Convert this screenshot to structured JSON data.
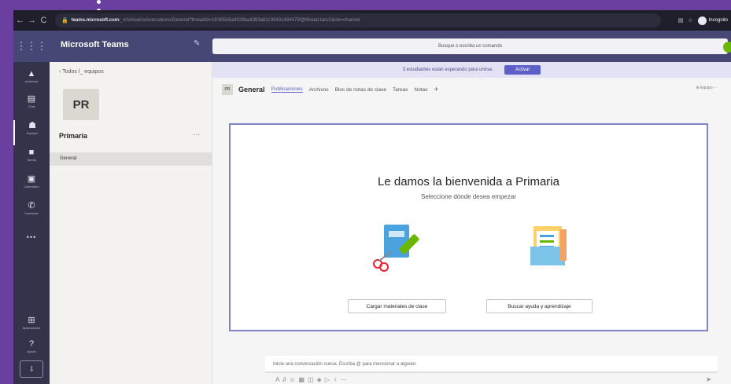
{
  "browser": {
    "host": "teams.microsoft.com",
    "path": "/_#/school/conversations/General?threadId=19:905b5a4028ba4383a81c39431484475f@thread.tacv2&ctx=channel",
    "incognito_label": "Incognito"
  },
  "header": {
    "app_title": "Microsoft Teams",
    "search_placeholder": "Busque o escriba un comando"
  },
  "rail": [
    {
      "label": "Actividad",
      "icon": "bell-icon"
    },
    {
      "label": "Chat",
      "icon": "chat-icon"
    },
    {
      "label": "Equipos",
      "icon": "teams-icon"
    },
    {
      "label": "Tareas",
      "icon": "assignments-icon"
    },
    {
      "label": "Calendario",
      "icon": "calendar-icon"
    },
    {
      "label": "Llamadas",
      "icon": "phone-icon"
    },
    {
      "label": "Aplicaciones",
      "icon": "apps-icon"
    },
    {
      "label": "Ayuda",
      "icon": "help-icon"
    }
  ],
  "teams_pane": {
    "back_label": "Todos l_ equipos",
    "team_initials": "PR",
    "team_name": "Primaria",
    "more": "···",
    "channels": [
      "General"
    ]
  },
  "banner": {
    "text": "3 estudiantes están esperando para unirse.",
    "action": "Activar"
  },
  "channel": {
    "initials": "PR",
    "name": "General",
    "tabs": [
      "Publicaciones",
      "Archivos",
      "Bloc de notas de clase",
      "Tareas",
      "Notas"
    ],
    "add_tab": "+",
    "team_button": "Equipo"
  },
  "welcome": {
    "title": "Le damos la bienvenida a Primaria",
    "subtitle": "Seleccione dónde desea empezar",
    "load_button": "Cargar materiales de clase",
    "help_button": "Buscar ayuda y aprendizaje"
  },
  "compose": {
    "placeholder": "Inicie una conversación nueva. Escriba @ para mencionar a alguien."
  },
  "colors": {
    "frame": "#6b3fa0",
    "header": "#464775",
    "rail": "#33344a",
    "accent": "#5b5fc7"
  }
}
